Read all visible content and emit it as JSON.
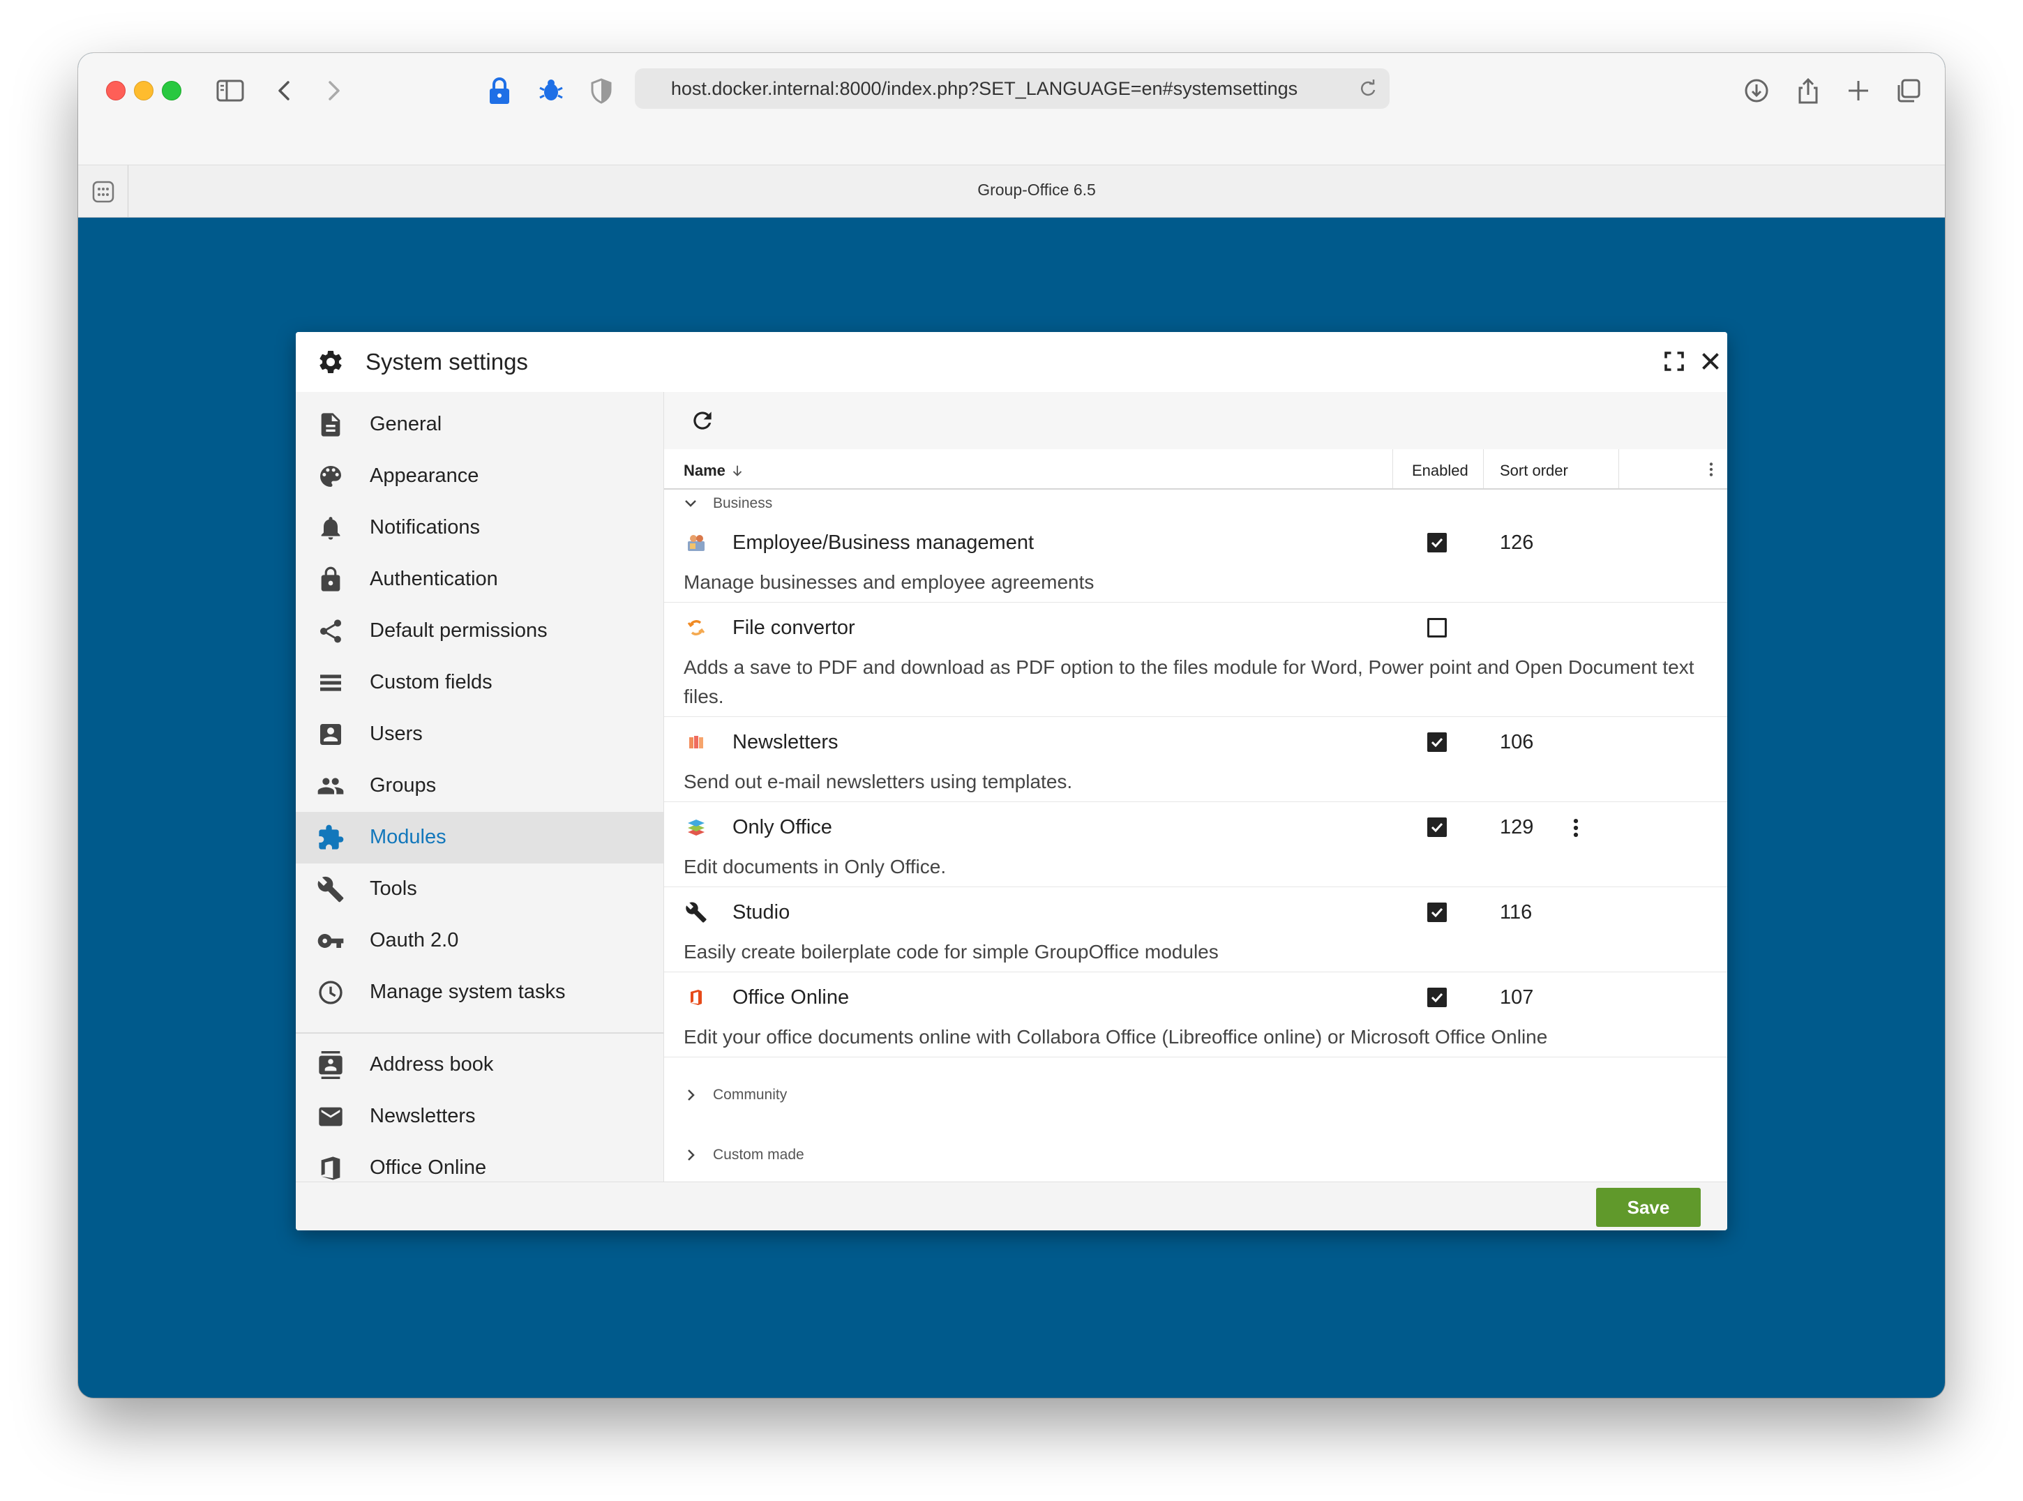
{
  "browser": {
    "url": "host.docker.internal:8000/index.php?SET_LANGUAGE=en#systemsettings",
    "tab_title": "Group-Office 6.5"
  },
  "dialog": {
    "title": "System settings",
    "save_label": "Save"
  },
  "sidebar": {
    "items": [
      {
        "label": "General",
        "icon": "document-icon"
      },
      {
        "label": "Appearance",
        "icon": "palette-icon"
      },
      {
        "label": "Notifications",
        "icon": "bell-icon"
      },
      {
        "label": "Authentication",
        "icon": "lock-icon"
      },
      {
        "label": "Default permissions",
        "icon": "share-icon"
      },
      {
        "label": "Custom fields",
        "icon": "list-icon"
      },
      {
        "label": "Users",
        "icon": "user-card-icon"
      },
      {
        "label": "Groups",
        "icon": "group-icon"
      },
      {
        "label": "Modules",
        "icon": "puzzle-icon",
        "selected": true
      },
      {
        "label": "Tools",
        "icon": "wrench-icon"
      },
      {
        "label": "Oauth 2.0",
        "icon": "key-icon"
      },
      {
        "label": "Manage system tasks",
        "icon": "clock-icon"
      }
    ],
    "module_items": [
      {
        "label": "Address book",
        "icon": "contacts-icon"
      },
      {
        "label": "Newsletters",
        "icon": "mail-icon"
      },
      {
        "label": "Office Online",
        "icon": "office-icon"
      }
    ]
  },
  "grid": {
    "columns": {
      "name": "Name",
      "enabled": "Enabled",
      "sort_order": "Sort order"
    },
    "groups": [
      {
        "label": "Business",
        "expanded": true,
        "modules": [
          {
            "name": "Employee/Business management",
            "description": "Manage businesses and employee agreements",
            "enabled": true,
            "sort_order": "126",
            "icon": "business-icon"
          },
          {
            "name": "File convertor",
            "description": "Adds a save to PDF and download as PDF option to the files module for Word, Power point and Open Document text files.",
            "enabled": false,
            "sort_order": "",
            "icon": "convert-icon"
          },
          {
            "name": "Newsletters",
            "description": "Send out e-mail newsletters using templates.",
            "enabled": true,
            "sort_order": "106",
            "icon": "newsletter-icon"
          },
          {
            "name": "Only Office",
            "description": "Edit documents in Only Office.",
            "enabled": true,
            "sort_order": "129",
            "icon": "onlyoffice-icon"
          },
          {
            "name": "Studio",
            "description": "Easily create boilerplate code for simple GroupOffice modules",
            "enabled": true,
            "sort_order": "116",
            "icon": "wrench-icon"
          },
          {
            "name": "Office Online",
            "description": "Edit your office documents online with Collabora Office (Libreoffice online) or Microsoft Office Online",
            "enabled": true,
            "sort_order": "107",
            "icon": "office-online-icon"
          }
        ]
      },
      {
        "label": "Community",
        "expanded": false
      },
      {
        "label": "Custom made",
        "expanded": false
      }
    ]
  },
  "colors": {
    "desktop_bg": "#005a8c",
    "accent_blue": "#1277bb",
    "save_green": "#60992b"
  }
}
